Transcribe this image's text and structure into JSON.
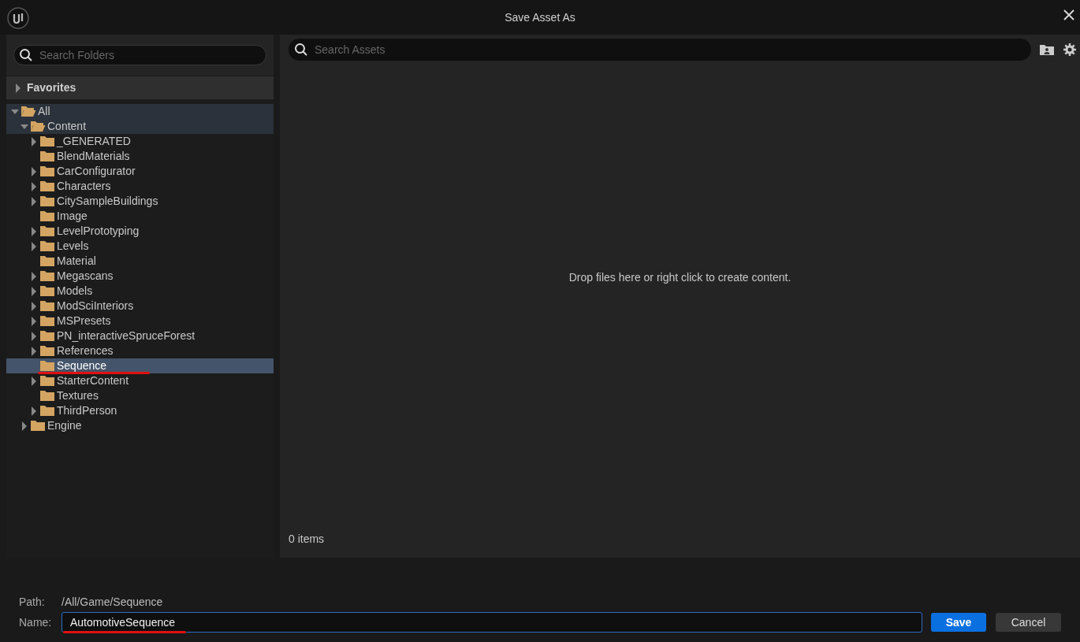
{
  "window": {
    "title": "Save Asset As"
  },
  "folder_search": {
    "placeholder": "Search Folders"
  },
  "favorites": {
    "label": "Favorites",
    "expanded": false
  },
  "tree": [
    {
      "label": "All",
      "kind": "expanded",
      "selected": false,
      "in_path": true,
      "annotated": false,
      "children": [
        {
          "label": "Content",
          "kind": "expanded",
          "selected": false,
          "in_path": true,
          "annotated": false,
          "children": [
            {
              "label": "_GENERATED",
              "kind": "collapsed",
              "selected": false,
              "in_path": false,
              "annotated": false
            },
            {
              "label": "BlendMaterials",
              "kind": "leaf",
              "selected": false,
              "in_path": false,
              "annotated": false
            },
            {
              "label": "CarConfigurator",
              "kind": "collapsed",
              "selected": false,
              "in_path": false,
              "annotated": false
            },
            {
              "label": "Characters",
              "kind": "collapsed",
              "selected": false,
              "in_path": false,
              "annotated": false
            },
            {
              "label": "CitySampleBuildings",
              "kind": "collapsed",
              "selected": false,
              "in_path": false,
              "annotated": false
            },
            {
              "label": "Image",
              "kind": "leaf",
              "selected": false,
              "in_path": false,
              "annotated": false
            },
            {
              "label": "LevelPrototyping",
              "kind": "collapsed",
              "selected": false,
              "in_path": false,
              "annotated": false
            },
            {
              "label": "Levels",
              "kind": "collapsed",
              "selected": false,
              "in_path": false,
              "annotated": false
            },
            {
              "label": "Material",
              "kind": "leaf",
              "selected": false,
              "in_path": false,
              "annotated": false
            },
            {
              "label": "Megascans",
              "kind": "collapsed",
              "selected": false,
              "in_path": false,
              "annotated": false
            },
            {
              "label": "Models",
              "kind": "collapsed",
              "selected": false,
              "in_path": false,
              "annotated": false
            },
            {
              "label": "ModSciInteriors",
              "kind": "collapsed",
              "selected": false,
              "in_path": false,
              "annotated": false
            },
            {
              "label": "MSPresets",
              "kind": "collapsed",
              "selected": false,
              "in_path": false,
              "annotated": false
            },
            {
              "label": "PN_interactiveSpruceForest",
              "kind": "collapsed",
              "selected": false,
              "in_path": false,
              "annotated": false
            },
            {
              "label": "References",
              "kind": "collapsed",
              "selected": false,
              "in_path": false,
              "annotated": false
            },
            {
              "label": "Sequence",
              "kind": "leaf",
              "selected": true,
              "in_path": false,
              "annotated": true
            },
            {
              "label": "StarterContent",
              "kind": "collapsed",
              "selected": false,
              "in_path": false,
              "annotated": false
            },
            {
              "label": "Textures",
              "kind": "leaf",
              "selected": false,
              "in_path": false,
              "annotated": false
            },
            {
              "label": "ThirdPerson",
              "kind": "collapsed",
              "selected": false,
              "in_path": false,
              "annotated": false
            }
          ]
        },
        {
          "label": "Engine",
          "kind": "collapsed",
          "selected": false,
          "in_path": false,
          "annotated": false
        }
      ]
    }
  ],
  "asset_search": {
    "placeholder": "Search Assets"
  },
  "empty_message": "Drop files here or right click to create content.",
  "item_count": "0 items",
  "path": {
    "label": "Path:",
    "value": "/All/Game/Sequence"
  },
  "name": {
    "label": "Name:",
    "value": "AutomotiveSequence",
    "annotated": true
  },
  "buttons": [
    {
      "label": "Save",
      "kind": "primary"
    },
    {
      "label": "Cancel",
      "kind": "secondary"
    }
  ]
}
